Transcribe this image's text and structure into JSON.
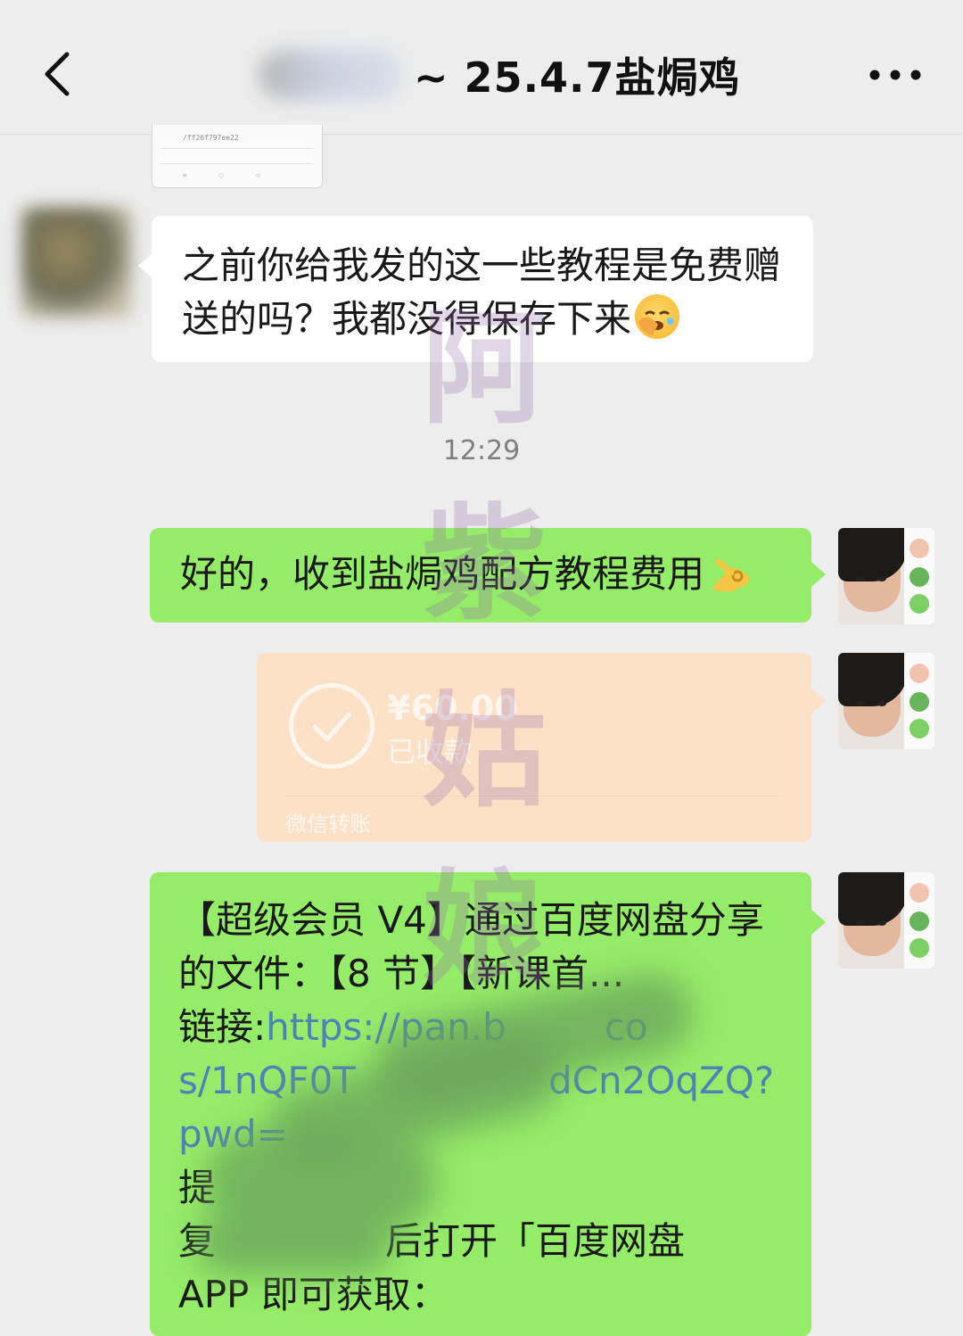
{
  "header": {
    "title": "~ 25.4.7盐焗鸡",
    "back_icon": "chevron-left-icon",
    "more_icon": "more-dots-icon"
  },
  "screenshot_thumb": {
    "url_fragment": "/ff26f797ee22"
  },
  "messages": [
    {
      "side": "left",
      "text": "之前你给我发的这一些教程是免费赠送的吗？我都没得保存下来",
      "emoji": "face-palm-crying-emoji"
    },
    {
      "side": "right",
      "text": "好的，收到盐焗鸡配方教程费用",
      "emoji": "ok-hand-emoji"
    },
    {
      "side": "right",
      "type": "transfer",
      "amount": "¥60.00",
      "status": "已收款",
      "label": "微信转账",
      "color": "#fde1c7"
    },
    {
      "side": "right",
      "line1": "【超级会员 V4】通过百度网盘分享",
      "line2": "的文件：【8 节】【新课首...",
      "line3_label": "链接:",
      "line3_link": "https://pan.b",
      "line3_tail": "co",
      "line4_head": "s/1nQF0T",
      "line4_tail": "dCn2OqZQ?",
      "line5": "pwd=",
      "line6": "提",
      "line7_head": "复",
      "line7_tail": "后打开「百度网盘",
      "line8": "APP 即可获取："
    }
  ],
  "timestamp": "12:29",
  "watermark": [
    "阿",
    "紫",
    "姑",
    "娘"
  ],
  "colors": {
    "background": "#ededed",
    "bubble_out": "#95ec69",
    "bubble_in": "#ffffff",
    "link": "#4e82b6"
  }
}
